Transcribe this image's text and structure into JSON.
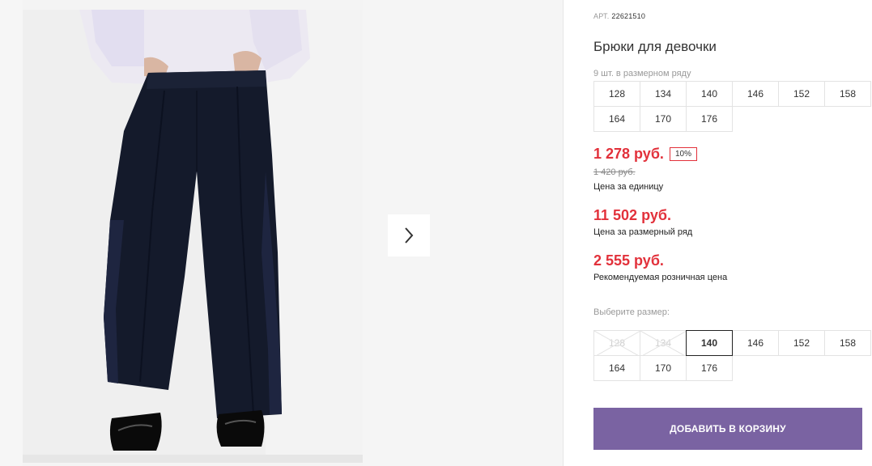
{
  "product": {
    "sku_label": "АРТ.",
    "sku_value": "22621510",
    "title": "Брюки для девочки"
  },
  "size_row": {
    "note": "9 шт. в размерном ряду",
    "sizes": [
      "128",
      "134",
      "140",
      "146",
      "152",
      "158",
      "164",
      "170",
      "176"
    ]
  },
  "prices": {
    "unit_price": "1 278 руб.",
    "discount_badge": "10%",
    "old_price": "1 420 руб.",
    "unit_caption": "Цена за единицу",
    "row_price": "11 502 руб.",
    "row_caption": "Цена за размерный ряд",
    "rrp_price": "2 555 руб.",
    "rrp_caption": "Рекомендуемая розничная цена"
  },
  "size_select": {
    "label": "Выберите размер:",
    "options": [
      "128",
      "134",
      "140",
      "146",
      "152",
      "158",
      "164",
      "170",
      "176"
    ],
    "unavailable": [
      "128",
      "134"
    ],
    "selected": "140"
  },
  "actions": {
    "add_to_cart": "ДОБАВИТЬ В КОРЗИНУ"
  },
  "colors": {
    "price_red": "#e2313b",
    "button_purple": "#7a63a2",
    "pants_navy": "#141a2b"
  },
  "icons": {
    "next": "chevron-right-icon"
  }
}
